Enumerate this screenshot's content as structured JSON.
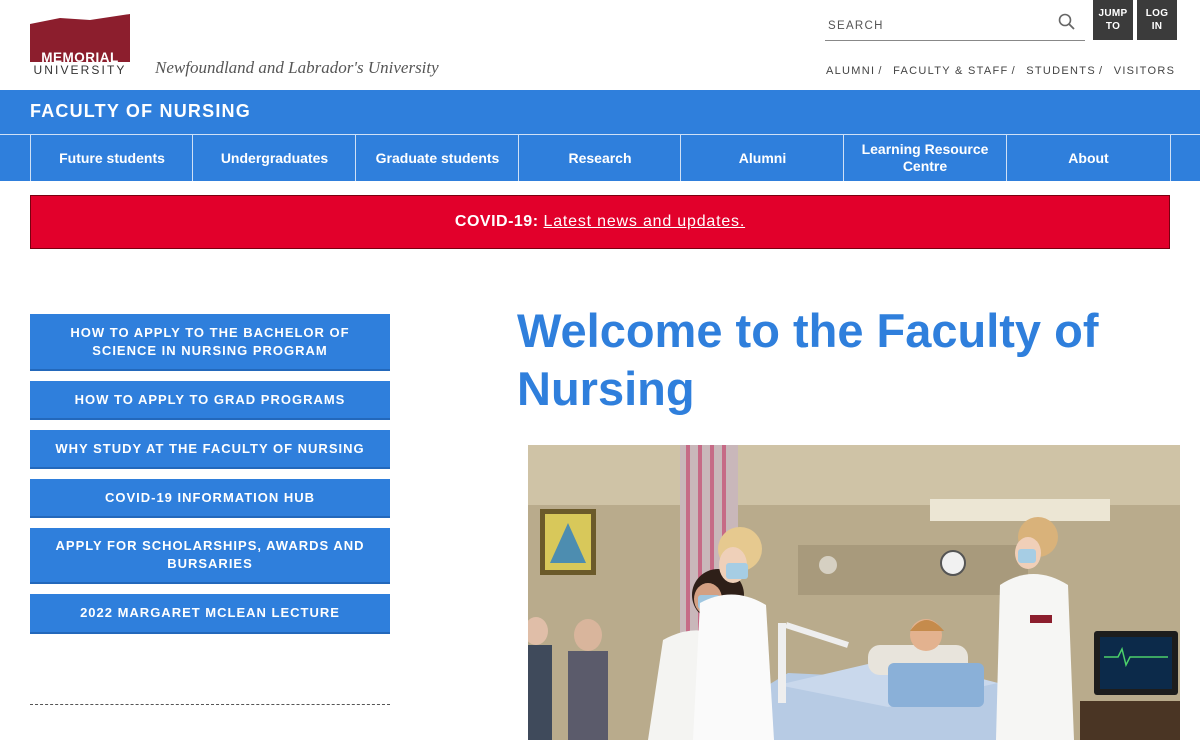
{
  "header": {
    "logo": {
      "word1": "MEMORIAL",
      "word2": "UNIVERSITY",
      "color": "#8c1e2d"
    },
    "tagline": "Newfoundland and Labrador's University",
    "search": {
      "placeholder": "SEARCH",
      "icon": "search-icon"
    },
    "jump_to_label": "JUMP TO",
    "log_in_label": "LOG IN",
    "audience_links": [
      {
        "label": "ALUMNI",
        "sep": "/"
      },
      {
        "label": "FACULTY & STAFF",
        "sep": "/"
      },
      {
        "label": "STUDENTS",
        "sep": "/"
      },
      {
        "label": "VISITORS",
        "sep": ""
      }
    ]
  },
  "faculty_title": "FACULTY OF NURSING",
  "nav": [
    {
      "label": "Future students"
    },
    {
      "label": "Undergraduates"
    },
    {
      "label": "Graduate students"
    },
    {
      "label": "Research"
    },
    {
      "label": "Alumni"
    },
    {
      "label": "Learning Resource Centre"
    },
    {
      "label": "About"
    }
  ],
  "covid_banner": {
    "prefix": "COVID-19:",
    "link_text": "Latest news and updates."
  },
  "sidebar": {
    "buttons": [
      {
        "label": "HOW TO APPLY TO THE BACHELOR OF SCIENCE IN NURSING PROGRAM"
      },
      {
        "label": "HOW TO APPLY TO GRAD PROGRAMS"
      },
      {
        "label": "WHY STUDY AT THE FACULTY OF NURSING"
      },
      {
        "label": "COVID-19 INFORMATION HUB"
      },
      {
        "label": "APPLY FOR SCHOLARSHIPS, AWARDS AND BURSARIES"
      },
      {
        "label": "2022 MARGARET MCLEAN LECTURE"
      }
    ]
  },
  "main": {
    "heading": "Welcome to the Faculty of Nursing"
  },
  "colors": {
    "brand_blue": "#2f7fdc",
    "covid_red": "#e2002b",
    "dark_button": "#3b3b3b",
    "maroon": "#8c1e2d"
  }
}
